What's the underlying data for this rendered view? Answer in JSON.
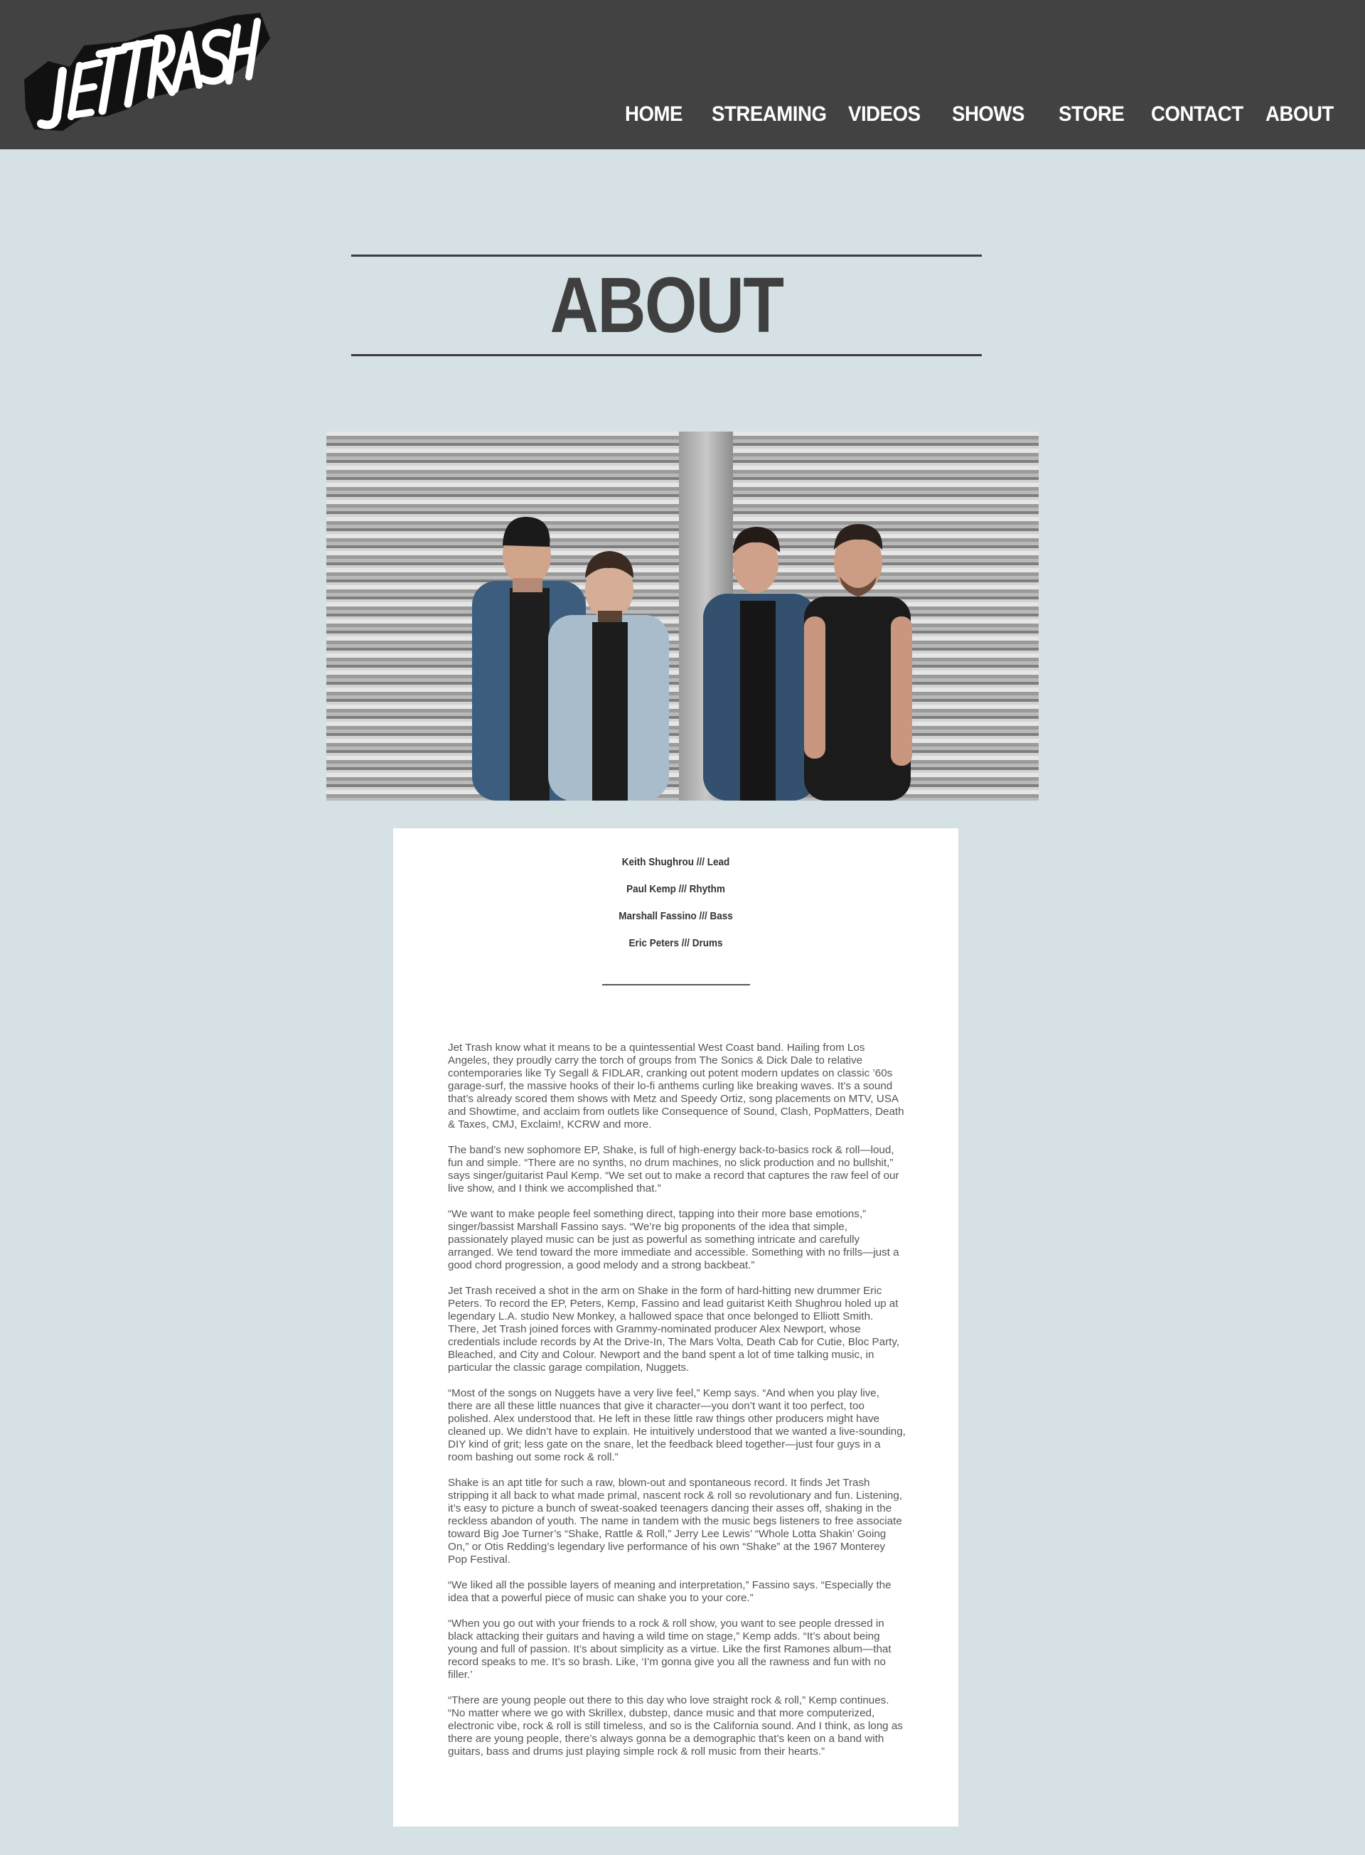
{
  "header": {
    "logo_text": "JETTRASH",
    "nav": [
      {
        "label": "HOME"
      },
      {
        "label": "STREAMING"
      },
      {
        "label": "VIDEOS"
      },
      {
        "label": "SHOWS"
      },
      {
        "label": "STORE"
      },
      {
        "label": "CONTACT"
      },
      {
        "label": "ABOUT"
      }
    ]
  },
  "page": {
    "title": "ABOUT"
  },
  "photo": {
    "alt": "Jet Trash band members leaning against a metal roller shutter"
  },
  "members": [
    "Keith Shughrou /// Lead",
    "Paul Kemp /// Rhythm",
    "Marshall Fassino /// Bass",
    "Eric Peters /// Drums"
  ],
  "bio": [
    "Jet Trash know what it means to be a quintessential West Coast band. Hailing from Los Angeles, they proudly carry the torch of groups from The Sonics & Dick Dale to relative contemporaries like Ty Segall & FIDLAR, cranking out potent modern updates on classic ’60s garage-surf, the massive hooks of their lo-fi anthems curling like breaking waves. It’s a sound that’s already scored them shows with Metz and Speedy Ortiz, song placements on MTV, USA and Showtime, and acclaim from outlets like Consequence of Sound, Clash, PopMatters, Death & Taxes, CMJ, Exclaim!, KCRW and more.",
    "The band’s new sophomore EP, Shake, is full of high-energy back-to-basics rock & roll—loud, fun and simple. “There are no synths, no drum machines, no slick production and no bullshit,” says singer/guitarist Paul Kemp. “We set out to make a record that captures the raw feel of our live show, and I think we accomplished that.”",
    "“We want to make people feel something direct, tapping into their more base emotions,” singer/bassist Marshall Fassino says. “We’re big proponents of the idea that simple, passionately played music can be just as powerful as something intricate and carefully arranged. We tend toward the more immediate and accessible. Something with no frills—just a good chord progression, a good melody and a strong backbeat.”",
    "Jet Trash received a shot in the arm on Shake in the form of hard-hitting new drummer Eric Peters. To record the EP, Peters, Kemp, Fassino and lead guitarist Keith Shughrou holed up at legendary L.A. studio New Monkey, a hallowed space that once belonged to Elliott Smith. There, Jet Trash joined forces with Grammy-nominated producer Alex Newport, whose credentials include records by At the Drive-In, The Mars Volta, Death Cab for Cutie, Bloc Party, Bleached, and City and Colour. Newport and the band spent a lot of time talking music, in particular the classic garage compilation, Nuggets.",
    "“Most of the songs on Nuggets have a very live feel,” Kemp says. “And when you play live, there are all these little nuances that give it character—you don’t want it too perfect, too polished. Alex understood that. He left in these little raw things other producers might have cleaned up. We didn’t have to explain. He intuitively understood that we wanted a live-sounding, DIY kind of grit; less gate on the snare, let the feedback bleed together—just four guys in a room bashing out some rock & roll.”",
    "Shake is an apt title for such a raw, blown-out and spontaneous record. It finds Jet Trash stripping it all back to what made primal, nascent rock & roll so revolutionary and fun. Listening, it’s easy to picture a bunch of sweat-soaked teenagers dancing their asses off, shaking in the reckless abandon of youth. The name in tandem with the music begs listeners to free associate toward Big Joe Turner’s “Shake, Rattle & Roll,” Jerry Lee Lewis’ “Whole Lotta Shakin’ Going On,” or Otis Redding’s legendary live performance of his own “Shake” at the 1967 Monterey Pop Festival.",
    "“We liked all the possible layers of meaning and interpretation,” Fassino says. “Especially the idea that a powerful piece of music can shake you to your core.”",
    "“When you go out with your friends to a rock & roll show, you want to see people dressed in black attacking their guitars and having a wild time on stage,” Kemp adds. “It’s about being young and full of passion. It’s about simplicity as a virtue. Like the first Ramones album—that record speaks to me. It’s so brash. Like, ‘I’m gonna give you all the rawness and fun with no filler.’",
    "“There are young people out there to this day who love straight rock & roll,” Kemp continues. “No matter where we go with Skrillex, dubstep, dance music and that more computerized, electronic vibe, rock & roll is still timeless, and so is the California sound. And I think, as long as there are young people, there’s always gonna be a demographic that’s keen on a band with guitars, bass and drums just playing simple rock & roll music from their hearts.”"
  ],
  "colors": {
    "header_bg": "#424242",
    "page_bg": "#d5e1e5",
    "card_bg": "#ffffff",
    "title": "#3f3f3f"
  }
}
